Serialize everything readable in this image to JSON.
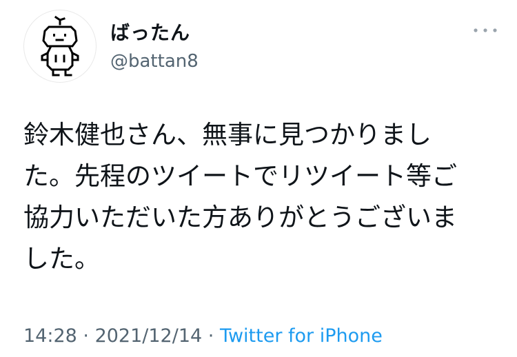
{
  "author": {
    "display_name": "ばったん",
    "handle": "@battan8",
    "avatar_icon": "pixel-character-avatar"
  },
  "more_icon": "more-options-icon",
  "tweet": {
    "text": "鈴木健也さん、無事に見つかりました。先程のツイートでリツイート等ご協力いただいた方ありがとうございました。"
  },
  "meta": {
    "time": "14:28",
    "separator1": " · ",
    "date": "2021/12/14",
    "separator2": " · ",
    "source": "Twitter for iPhone"
  },
  "colors": {
    "text": "#0f1419",
    "secondary": "#536471",
    "link": "#1d9bf0"
  }
}
